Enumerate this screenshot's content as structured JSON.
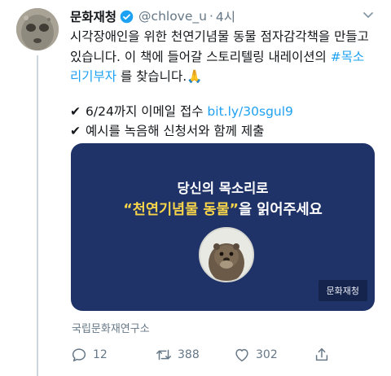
{
  "tweet": {
    "display_name": "문화재청",
    "handle": "@chlove_u",
    "separator": "·",
    "time": "4시",
    "text_lines": [
      "시각장애인을 위한 천연기념물 동물 점자감각책을 만들고",
      "있습니다. 이 책에 들어갈 스토리텔링 내레이션의 ",
      "리기부자",
      " 를 찾습니다.",
      "🙏"
    ],
    "hashtag_part1": "#목소",
    "bullet1_text": "6/24까지 이메일 접수 ",
    "bullet1_link": "bit.ly/30sgul9",
    "bullet2_text": "예시를 녹음해 신청서와 함께 제출",
    "check": "✔"
  },
  "card": {
    "title_line1": "당신의 목소리로",
    "title_quote": "“천연기념물 동물”",
    "title_rest": "을 읽어주세요",
    "badge": "문화재청"
  },
  "source": "국립문화재연구소",
  "actions": {
    "replies": "12",
    "retweets": "388",
    "likes": "302"
  },
  "colors": {
    "link": "#1da1f2",
    "card_bg": "#1f3368",
    "highlight": "#f7d44a"
  }
}
